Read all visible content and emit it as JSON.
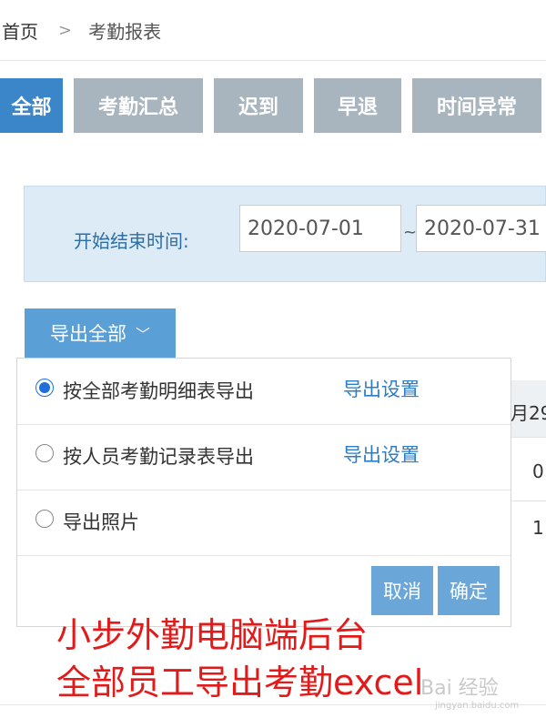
{
  "breadcrumb": {
    "home": "首页",
    "separator": ">",
    "current": "考勤报表"
  },
  "tabs": [
    {
      "label": "全部",
      "active": true
    },
    {
      "label": "考勤汇总",
      "active": false
    },
    {
      "label": "迟到",
      "active": false
    },
    {
      "label": "早退",
      "active": false
    },
    {
      "label": "时间异常",
      "active": false
    }
  ],
  "filter": {
    "label": "开始结束时间:",
    "start_date": "2020-07-01",
    "separator": "~",
    "end_date": "2020-07-31"
  },
  "export_button": {
    "label": "导出全部",
    "chevron": "﹀"
  },
  "dropdown": {
    "options": [
      {
        "label": "按全部考勤明细表导出",
        "link": "导出设置",
        "checked": true
      },
      {
        "label": "按人员考勤记录表导出",
        "link": "导出设置",
        "checked": false
      },
      {
        "label": "导出照片",
        "checked": false
      }
    ],
    "cancel_label": "取消",
    "confirm_label": "确定"
  },
  "table_partial": {
    "header": "月29",
    "row1": "0",
    "row2": "1"
  },
  "caption": {
    "line1": "小步外勤电脑端后台",
    "line2": "全部员工导出考勤excel"
  },
  "watermark": {
    "text": "Bai 经验",
    "sub": "jingyan.baidu.com"
  },
  "colors": {
    "tab_active": "#3a86c8",
    "tab_inactive": "#a8b5bf",
    "link": "#2d7cc7",
    "caption": "#e21a1a"
  }
}
